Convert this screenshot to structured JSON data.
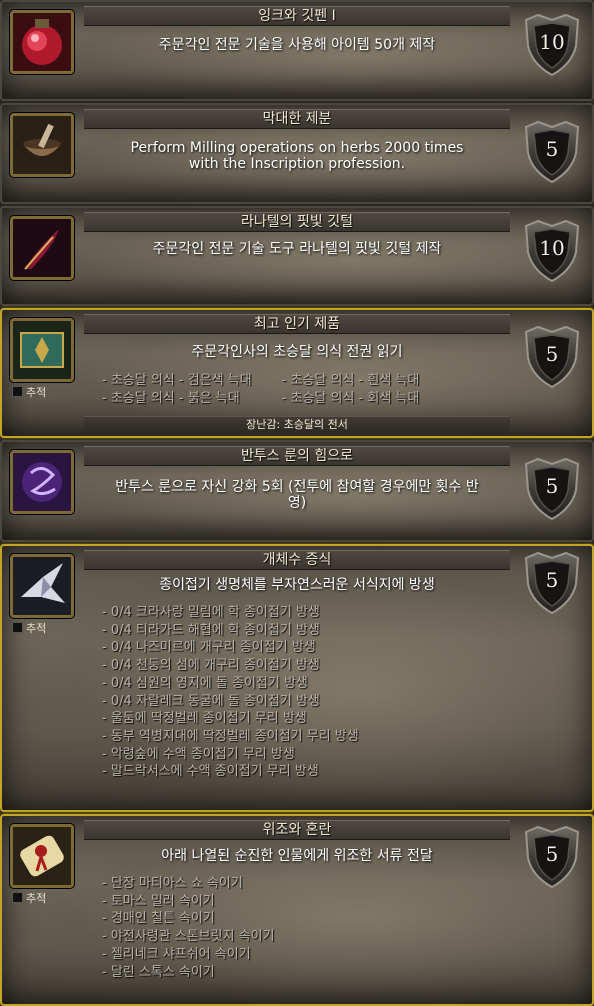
{
  "colors": {
    "expanded_border": "#c2a522",
    "collapsed_border": "#4a4741",
    "criteria_text": "#b8b3a8"
  },
  "achievements": [
    {
      "title": "잉크와 깃펜 I",
      "description": "주문각인 전문 기술을 사용해 아이템 50개 제작",
      "points": "10",
      "icon": "red-ink-bottle-icon",
      "toggle": "+"
    },
    {
      "title": "막대한 제분",
      "description_line1": "Perform Milling operations on herbs 2000 times",
      "description_line2": "with the Inscription profession.",
      "points": "5",
      "icon": "mortar-pestle-icon",
      "toggle": "+"
    },
    {
      "title": "라나텔의 핏빛 깃털",
      "description": "주문각인 전문 기술 도구 라나텔의 핏빛 깃털 제작",
      "points": "10",
      "icon": "crimson-quill-icon",
      "toggle": "+"
    },
    {
      "title": "최고 인기 제품",
      "description": "주문각인사의 초승달 의식 전권 읽기",
      "points": "5",
      "icon": "green-tome-icon",
      "toggle": "−",
      "track_label": "추적",
      "criteria_left": [
        "- 초승달 의식 - 검은색 늑대",
        "- 초승달 의식 - 붉은 늑대"
      ],
      "criteria_right": [
        "- 초승달 의식 - 흰색 늑대",
        "- 초승달 의식 - 회색 늑대"
      ],
      "reward": "장난감: 초승달의 전서"
    },
    {
      "title": "반투스 룬의 힘으로",
      "description_line1": "반투스 룬으로 자신 강화 5회 (전투에 참여할 경우에만 횟수 반",
      "description_line2": "영)",
      "points": "5",
      "icon": "purple-rune-icon",
      "toggle": "+"
    },
    {
      "title": "개체수 증식",
      "description": "종이접기 생명체를 부자연스러운 서식지에 방생",
      "points": "5",
      "icon": "paper-crane-icon",
      "toggle": "−",
      "track_label": "추적",
      "criteria": [
        "- 0/4 크라사랑 밀림에 학 종이접기 방생",
        "- 0/4 티라가드 해협에 학 종이접기 방생",
        "- 0/4 나즈미르에 개구리 종이접기 방생",
        "- 0/4 천둥의 섬에 개구리 종이접기 방생",
        "- 0/4 심원의 영지에 돌 종이접기 방생",
        "- 0/4 자랄레크 동굴에 돌 종이접기 방생",
        "- 울둠에 딱정벌레 종이접기 무리 방생",
        "- 동부 역병지대에 딱정벌레 종이접기 무리 방생",
        "- 악령숲에 수액 종이접기 무리 방생",
        "- 말드락서스에 수액 종이접기 무리 방생"
      ]
    },
    {
      "title": "위조와 혼란",
      "description": "아래 나열된 순진한 인물에게 위조한 서류 전달",
      "points": "5",
      "icon": "sealed-scroll-icon",
      "toggle": "−",
      "track_label": "추적",
      "criteria": [
        "- 단장 마티아스 쇼 속이기",
        "- 토마스 밀러 속이기",
        "- 경매인 칠튼 속이기",
        "- 야전사령관 스톤브릿지 속이기",
        "- 젤리네크 샤프쉬어 속이기",
        "- 달린 스톡스 속이기"
      ]
    }
  ]
}
